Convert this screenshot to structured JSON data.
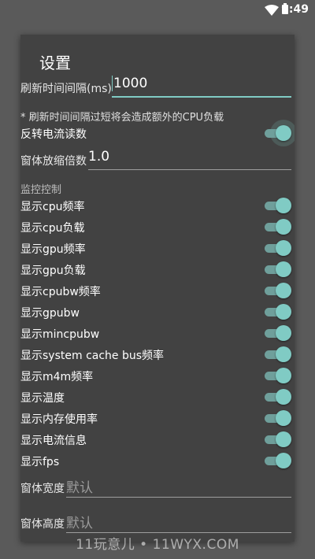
{
  "status_bar": {
    "time": "9:49",
    "wifi_icon": "wifi-icon",
    "battery_icon": "battery-icon"
  },
  "dialog": {
    "title": "设置",
    "refresh_interval": {
      "label": "刷新时间间隔(ms)",
      "value": "1000"
    },
    "refresh_note": "* 刷新时间间隔过短将会造成额外的CPU负载",
    "reverse_current": {
      "label": "反转电流读数",
      "enabled": true
    },
    "scale": {
      "label": "窗体放缩倍数",
      "value": "1.0"
    },
    "monitor_section": "监控控制",
    "toggles": [
      {
        "label": "显示cpu频率",
        "enabled": true
      },
      {
        "label": "显示cpu负载",
        "enabled": true
      },
      {
        "label": "显示gpu频率",
        "enabled": true
      },
      {
        "label": "显示gpu负载",
        "enabled": true
      },
      {
        "label": "显示cpubw频率",
        "enabled": true
      },
      {
        "label": "显示gpubw",
        "enabled": true
      },
      {
        "label": "显示mincpubw",
        "enabled": true
      },
      {
        "label": "显示system cache bus频率",
        "enabled": true
      },
      {
        "label": "显示m4m频率",
        "enabled": true
      },
      {
        "label": "显示温度",
        "enabled": true
      },
      {
        "label": "显示内存使用率",
        "enabled": true
      },
      {
        "label": "显示电流信息",
        "enabled": true
      },
      {
        "label": "显示fps",
        "enabled": true
      }
    ],
    "window_width": {
      "label": "窗体宽度",
      "placeholder": "默认"
    },
    "window_height": {
      "label": "窗体高度",
      "placeholder": "默认"
    }
  },
  "colors": {
    "accent": "#80cbc4",
    "dialog_bg": "#424242",
    "screen_bg": "#5a5a5a"
  },
  "watermark": "11玩意儿 • 11WYX.COM"
}
